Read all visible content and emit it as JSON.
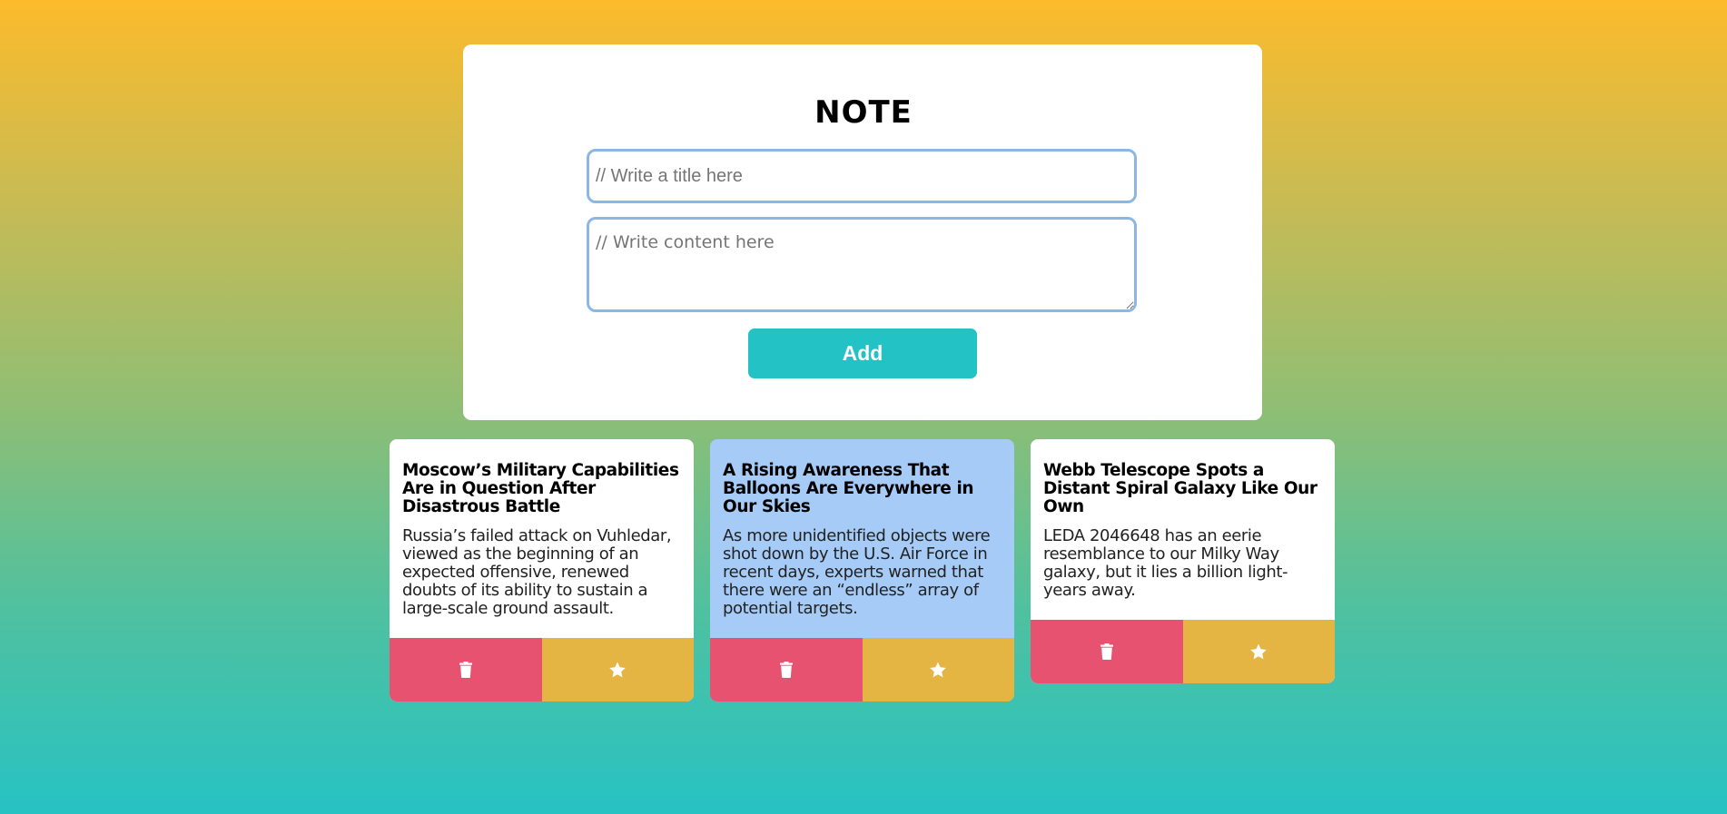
{
  "form": {
    "heading": "NOTE",
    "title_placeholder": "// Write a title here",
    "content_placeholder": "// Write content here",
    "add_label": "Add"
  },
  "colors": {
    "add_button": "#23c2c5",
    "delete_button": "#e75270",
    "star_button": "#e5b543",
    "highlighted_note": "#a6cbf6",
    "input_border": "#8eb6e4"
  },
  "notes": [
    {
      "title": "Moscow’s Military Capabilities Are in Question After Disastrous Battle",
      "content": "Russia’s failed attack on Vuhledar, viewed as the beginning of an expected offensive, renewed doubts of its ability to sustain a large-scale ground assault.",
      "highlighted": false,
      "delete_icon": "trash-icon",
      "star_icon": "star-icon"
    },
    {
      "title": "A Rising Awareness That Balloons Are Everywhere in Our Skies",
      "content": "As more unidentified objects were shot down by the U.S. Air Force in recent days, experts warned that there were an “endless” array of potential targets.",
      "highlighted": true,
      "delete_icon": "trash-icon",
      "star_icon": "star-icon"
    },
    {
      "title": "Webb Telescope Spots a Distant Spiral Galaxy Like Our Own",
      "content": "LEDA 2046648 has an eerie resemblance to our Milky Way galaxy, but it lies a billion light-years away.",
      "highlighted": false,
      "delete_icon": "trash-icon",
      "star_icon": "star-icon"
    }
  ]
}
